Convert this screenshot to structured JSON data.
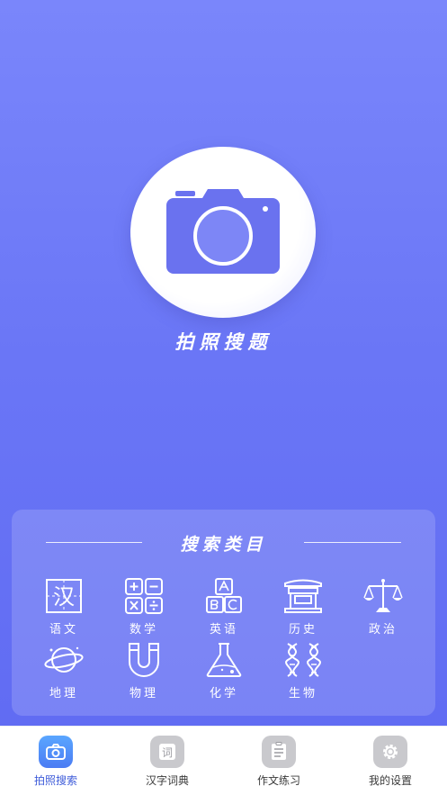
{
  "hero": {
    "title": "拍照搜题",
    "icon": "camera-icon"
  },
  "categories": {
    "title": "搜索类目",
    "items": [
      {
        "label": "语文",
        "icon": "chinese-character-icon"
      },
      {
        "label": "数学",
        "icon": "math-operators-icon"
      },
      {
        "label": "英语",
        "icon": "letter-blocks-icon"
      },
      {
        "label": "历史",
        "icon": "ancient-building-icon"
      },
      {
        "label": "政治",
        "icon": "balance-scale-icon"
      },
      {
        "label": "地理",
        "icon": "planet-icon"
      },
      {
        "label": "物理",
        "icon": "magnet-icon"
      },
      {
        "label": "化学",
        "icon": "flask-icon"
      },
      {
        "label": "生物",
        "icon": "dna-icon"
      }
    ],
    "chinese_glyph": "汉"
  },
  "tabbar": {
    "tabs": [
      {
        "label": "拍照搜索",
        "icon": "camera-icon",
        "active": true
      },
      {
        "label": "汉字词典",
        "icon": "dictionary-icon",
        "glyph": "词"
      },
      {
        "label": "作文练习",
        "icon": "document-icon"
      },
      {
        "label": "我的设置",
        "icon": "gear-icon"
      }
    ]
  },
  "colors": {
    "accent": "#6a76f6",
    "active_tab": "#3d5bd9"
  }
}
